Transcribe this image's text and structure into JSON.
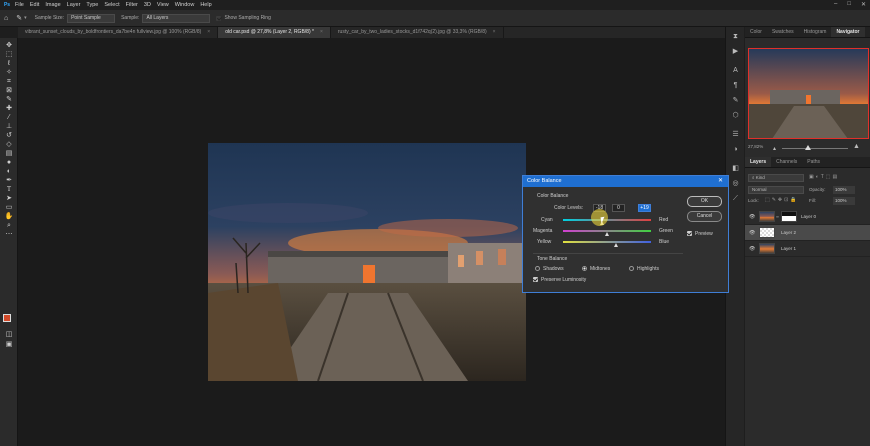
{
  "menubar": {
    "app_icon": "Ps",
    "items": [
      "File",
      "Edit",
      "Image",
      "Layer",
      "Type",
      "Select",
      "Filter",
      "3D",
      "View",
      "Window",
      "Help"
    ],
    "window_controls": [
      "–",
      "□",
      "✕"
    ]
  },
  "options": {
    "tool_icon": "eyedropper-icon",
    "sample_size_label": "Sample Size:",
    "sample_size_value": "Point Sample",
    "sample_label": "Sample:",
    "sample_value": "All Layers",
    "show_ring_label": "Show Sampling Ring"
  },
  "tabs": [
    {
      "label": "vibrant_sunset_clouds_by_boldfrontiers_da7be4n fullview.jpg @ 100% (RGB/8)",
      "active": false
    },
    {
      "label": "old car.psd @ 27,8% (Layer 2, RGB/8) *",
      "active": true
    },
    {
      "label": "rusty_car_by_two_ladies_stocks_d1f742q(2).jpg @ 33,3% (RGB/8)",
      "active": false
    }
  ],
  "tools": [
    "move",
    "marquee",
    "lasso",
    "quick-select",
    "crop",
    "frame",
    "eyedropper",
    "healing",
    "brush",
    "stamp",
    "history-brush",
    "eraser",
    "gradient",
    "blur",
    "dodge",
    "pen",
    "type",
    "path-select",
    "shape",
    "hand",
    "zoom",
    "more"
  ],
  "navigator": {
    "tabs": [
      "Color",
      "Swatches",
      "Histogram",
      "Navigator"
    ],
    "active_tab": "Navigator",
    "zoom": "27,82%"
  },
  "layers_panel": {
    "tabs": [
      "Layers",
      "Channels",
      "Paths"
    ],
    "active_tab": "Layers",
    "kind_label": "Kind",
    "blend_mode": "Normal",
    "opacity_label": "Opacity:",
    "opacity_value": "100%",
    "lock_label": "Lock:",
    "fill_label": "Fill:",
    "fill_value": "100%",
    "layers": [
      {
        "name": "Layer 0",
        "selected": false,
        "has_mask": true
      },
      {
        "name": "Layer 2",
        "selected": true,
        "has_mask": false
      },
      {
        "name": "Layer 1",
        "selected": false,
        "has_mask": false
      }
    ]
  },
  "dialog": {
    "title": "Color Balance",
    "close": "✕",
    "group_color_balance": "Color Balance",
    "color_levels_label": "Color Levels:",
    "levels": [
      "-18",
      "0",
      "+19"
    ],
    "sliders": [
      {
        "left": "Cyan",
        "right": "Red",
        "value": -18
      },
      {
        "left": "Magenta",
        "right": "Green",
        "value": 0
      },
      {
        "left": "Yellow",
        "right": "Blue",
        "value": 19
      }
    ],
    "group_tone_balance": "Tone Balance",
    "tones": [
      {
        "label": "Shadows",
        "selected": false
      },
      {
        "label": "Midtones",
        "selected": true
      },
      {
        "label": "Highlights",
        "selected": false
      }
    ],
    "preserve_luminosity": "Preserve Luminosity",
    "ok": "OK",
    "cancel": "Cancel",
    "preview": "Preview"
  }
}
